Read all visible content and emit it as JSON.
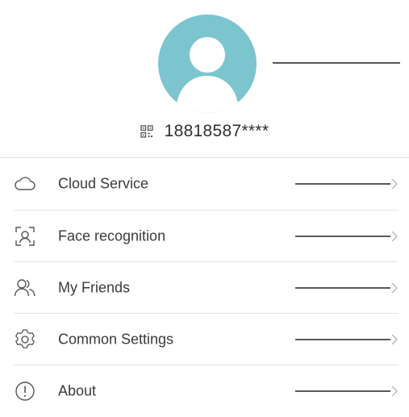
{
  "profile": {
    "phone": "18818587****",
    "avatar_color": "#7cc5cf"
  },
  "menu": {
    "items": [
      {
        "label": "Cloud Service",
        "icon": "cloud-icon"
      },
      {
        "label": "Face recognition",
        "icon": "face-scan-icon"
      },
      {
        "label": "My Friends",
        "icon": "friends-icon"
      },
      {
        "label": "Common Settings",
        "icon": "gear-icon"
      },
      {
        "label": "About",
        "icon": "info-icon"
      }
    ]
  }
}
